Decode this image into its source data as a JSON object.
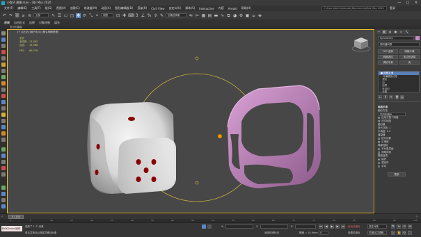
{
  "window": {
    "title": "小骰子 建模.max - 3ds Max 2020",
    "controls": [
      "—",
      "□",
      "✕"
    ]
  },
  "menu": {
    "items": [
      "文件(F)",
      "编辑(E)",
      "工具(T)",
      "组(G)",
      "视图(V)",
      "创建(C)",
      "修改器(M)",
      "动画(A)",
      "图形编辑器(D)",
      "渲染(R)",
      "Civil View",
      "自定义(U)",
      "脚本(S)",
      "Interactive",
      "内容",
      "Arnold",
      "帮助(H)"
    ],
    "search_value": "C:\\Users\\Administrator\\Documents\\3ds Max 2020",
    "signin": "登录"
  },
  "toolbar": {
    "selection_filter": "全部",
    "view_dropdown": "视图",
    "named_selection": "创建选择集"
  },
  "ribbon": {
    "tabs": [
      "建模",
      "自由形式",
      "选择",
      "对象绘制",
      "填充"
    ],
    "active": 0,
    "sublabel": "多边形建模"
  },
  "viewport": {
    "label": "[+] [正交] [用户定义] [默认明暗处理]",
    "stats": [
      {
        "k": "总计",
        "v": ""
      },
      {
        "k": "多边形:",
        "v": "13,392"
      },
      {
        "k": "顶点:",
        "v": "13,386"
      },
      {
        "k": "FPS:",
        "v": "69.749"
      }
    ]
  },
  "cmdpanel": {
    "tabs": [
      "+",
      "◧",
      "▤",
      "●",
      "▭",
      "🔧"
    ],
    "object_name": "Sphere001",
    "modifier_list": "修改器列表",
    "buttons": [
      "FFD 选择",
      "网格平滑",
      "网格选择",
      "多边形选择",
      "涡轮平滑",
      "壳"
    ],
    "stack": [
      {
        "label": "● 网格平滑",
        "selected": true
      },
      {
        "label": "◦ 可编辑多边形",
        "selected": false
      },
      {
        "label": "· 顶点",
        "selected": false
      },
      {
        "label": "· 边",
        "selected": false
      },
      {
        "label": "· 边界",
        "selected": false
      },
      {
        "label": "· 多边形",
        "selected": false
      },
      {
        "label": "· 元素",
        "selected": false
      }
    ],
    "rollout_title": "网格平滑",
    "rollout_opts": [
      {
        "kind": "hdr",
        "label": "细分方法"
      },
      {
        "kind": "drop",
        "label": "四边形输出"
      },
      {
        "kind": "chk",
        "label": "应用于整个网格"
      },
      {
        "kind": "chk",
        "label": "旧式贴图"
      },
      {
        "kind": "hdr",
        "label": "细分量"
      },
      {
        "kind": "opt",
        "label": "迭代次数: 1"
      },
      {
        "kind": "opt",
        "label": "平滑度: 1.0"
      },
      {
        "kind": "hdr",
        "label": "渲染值"
      },
      {
        "kind": "chk",
        "label": "迭代次数"
      },
      {
        "kind": "chk",
        "label": "平滑度"
      },
      {
        "kind": "hdr",
        "label": "局部控制"
      },
      {
        "kind": "rad_on",
        "label": "子对象层级"
      },
      {
        "kind": "opt",
        "label": "忽略背面"
      },
      {
        "kind": "hdr",
        "label": "更新选项"
      },
      {
        "kind": "rad_on",
        "label": "始终"
      },
      {
        "kind": "rad",
        "label": "渲染时"
      },
      {
        "kind": "rad",
        "label": "手动"
      },
      {
        "kind": "btn",
        "label": "更新"
      }
    ]
  },
  "timeline": {
    "frame": "0 / 100",
    "ticks": [
      "0",
      "5",
      "10",
      "15",
      "20",
      "25",
      "30",
      "35",
      "40",
      "45",
      "50",
      "55",
      "60",
      "65",
      "70",
      "75",
      "80",
      "85",
      "90",
      "95",
      "100"
    ]
  },
  "status": {
    "script_label": "MAXScript 迷你",
    "selected": "选择了 1 个 对象",
    "prompt": "单击并拖动以选择并移动对象",
    "x_label": "X:",
    "y_label": "Y:",
    "z_label": "Z:",
    "grid": "栅格 = 10.0mm",
    "addtime": "添加时间标记",
    "autokey": "自动关键点",
    "selset": "选定对象",
    "setkey": "设置关键点",
    "keyfilters": "关键点过滤器...",
    "frame_field": "0"
  },
  "colors": {
    "accent": "#5a8ac6",
    "viewport_border": "#f0c030",
    "stats_text": "#d2d26a",
    "dice_white": "#e8e8e8",
    "dice_pip": "#8a0000",
    "cage_pink": "#c98ac6",
    "gizmo_ring": "#c8b040"
  }
}
